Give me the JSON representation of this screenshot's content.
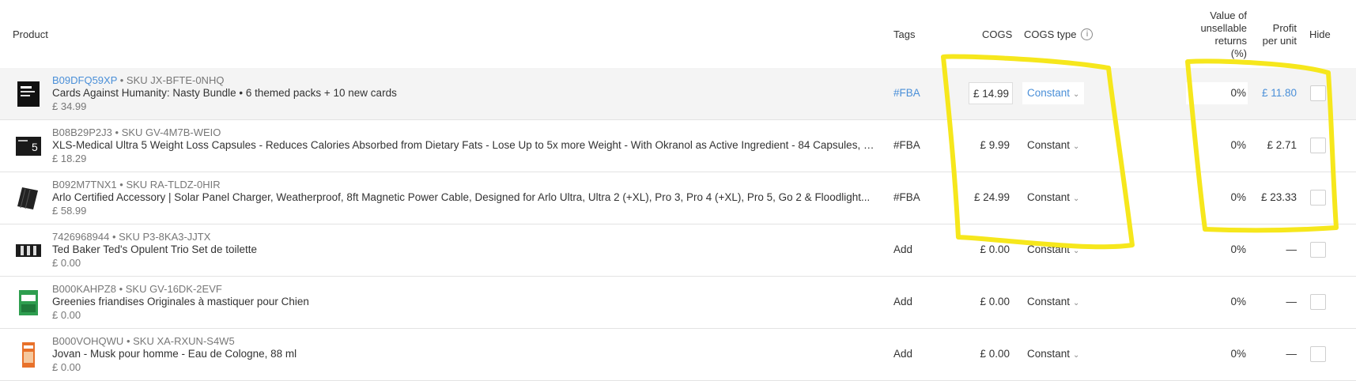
{
  "header": {
    "product": "Product",
    "tags": "Tags",
    "cogs": "COGS",
    "cogs_type": "COGS type",
    "info_icon": "info-icon",
    "value_unsellable_1": "Value of",
    "value_unsellable_2": "unsellable",
    "value_unsellable_3": "returns",
    "value_unsellable_4": "(%)",
    "profit_1": "Profit",
    "profit_2": "per unit",
    "hide": "Hide"
  },
  "rows": [
    {
      "asin": "B09DFQ59XP",
      "sku": "• SKU JX-BFTE-0NHQ",
      "title": "Cards Against Humanity: Nasty Bundle • 6 themed packs + 10 new cards",
      "price": "£ 34.99",
      "tag": "#FBA",
      "cogs": "£ 14.99",
      "cogs_type": "Constant",
      "vur": "0%",
      "profit": "£ 11.80",
      "thumb_icon": "card-box-icon"
    },
    {
      "asin": "B08B29P2J3",
      "sku": "• SKU GV-4M7B-WEIO",
      "title": "XLS-Medical Ultra 5 Weight Loss Capsules - Reduces Calories Absorbed from Dietary Fats - Lose Up to 5x more Weight - With Okranol as Active Ingredient - 84 Capsules, 2...",
      "price": "£ 18.29",
      "tag": "#FBA",
      "cogs": "£ 9.99",
      "cogs_type": "Constant",
      "vur": "0%",
      "profit": "£ 2.71",
      "thumb_icon": "capsule-box-icon"
    },
    {
      "asin": "B092M7TNX1",
      "sku": "• SKU RA-TLDZ-0HIR",
      "title": "Arlo Certified Accessory | Solar Panel Charger, Weatherproof, 8ft Magnetic Power Cable, Designed for Arlo Ultra, Ultra 2 (+XL), Pro 3, Pro 4 (+XL), Pro 5, Go 2 & Floodlight...",
      "price": "£ 58.99",
      "tag": "#FBA",
      "cogs": "£ 24.99",
      "cogs_type": "Constant",
      "vur": "0%",
      "profit": "£ 23.33",
      "thumb_icon": "solar-panel-icon"
    },
    {
      "asin": "7426968944",
      "sku": "• SKU P3-8KA3-JJTX",
      "title": "Ted Baker Ted's Opulent Trio Set de toilette",
      "price": "£ 0.00",
      "tag": "Add",
      "cogs": "£ 0.00",
      "cogs_type": "Constant",
      "vur": "0%",
      "profit": "—",
      "thumb_icon": "gift-set-icon"
    },
    {
      "asin": "B000KAHPZ8",
      "sku": "• SKU GV-16DK-2EVF",
      "title": "Greenies friandises Originales à mastiquer pour Chien",
      "price": "£ 0.00",
      "tag": "Add",
      "cogs": "£ 0.00",
      "cogs_type": "Constant",
      "vur": "0%",
      "profit": "—",
      "thumb_icon": "dog-treat-icon"
    },
    {
      "asin": "B000VOHQWU",
      "sku": "• SKU XA-RXUN-S4W5",
      "title": "Jovan - Musk pour homme - Eau de Cologne, 88 ml",
      "price": "£ 0.00",
      "tag": "Add",
      "cogs": "£ 0.00",
      "cogs_type": "Constant",
      "vur": "0%",
      "profit": "—",
      "thumb_icon": "cologne-bottle-icon"
    }
  ],
  "colors": {
    "link": "#4a8fd8",
    "highlight_marker": "#f6e71c",
    "row_highlight": "#f4f4f4"
  }
}
